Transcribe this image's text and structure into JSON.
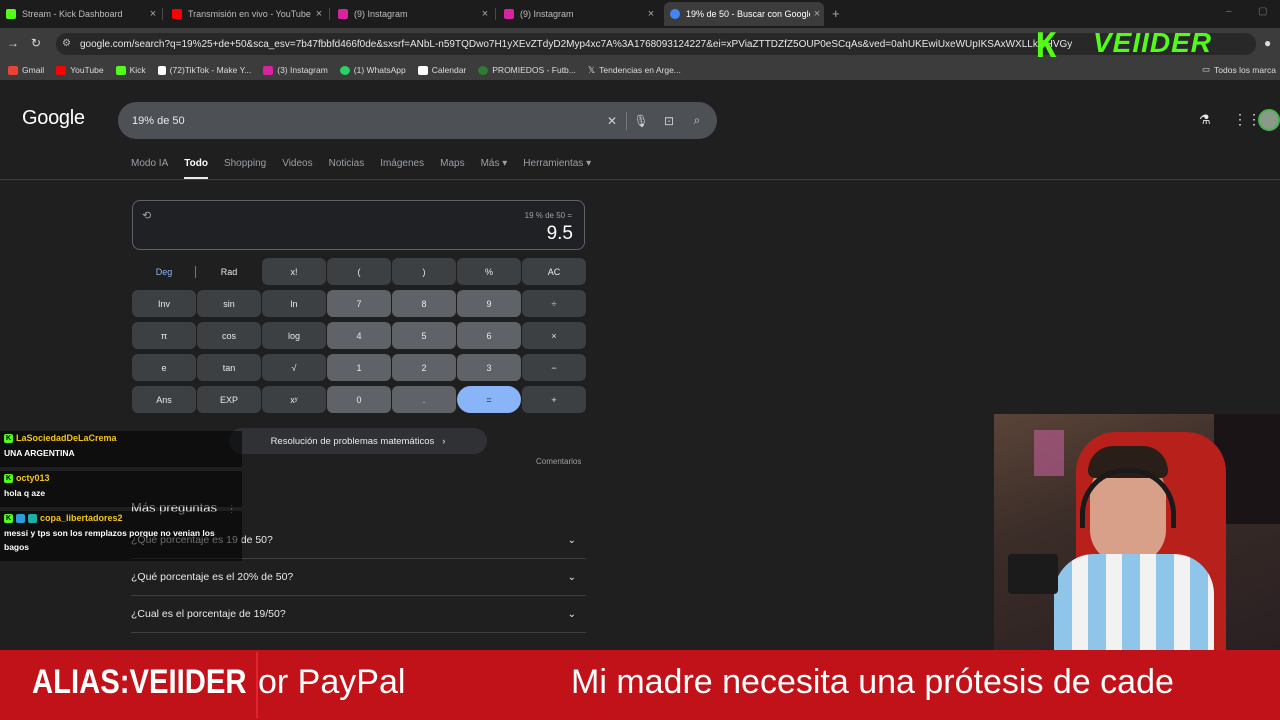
{
  "browser": {
    "tabs": [
      {
        "title": "Stream - Kick Dashboard",
        "icon": "kick-icon",
        "color": "#53fc18"
      },
      {
        "title": "Transmisión en vivo - YouTube",
        "icon": "youtube-icon",
        "color": "#ff0000"
      },
      {
        "title": "(9) Instagram",
        "icon": "instagram-icon",
        "color": "#d6249f"
      },
      {
        "title": "(9) Instagram",
        "icon": "instagram-icon",
        "color": "#d6249f"
      },
      {
        "title": "19% de 50 - Buscar con Google",
        "icon": "google-icon",
        "color": "#4285f4"
      }
    ],
    "url": "google.com/search?q=19%25+de+50&sca_esv=7b47fbbfd466f0de&sxsrf=ANbL-n59TQDwo7H1yXEvZTdyD2Myp4xc7A%3A1768093124227&ei=xPViaZTTDZfZ5OUP0eSCqAs&ved=0ahUKEwiUxeWUpIKSAxWXLLkGHVGy",
    "bookmarks": [
      {
        "label": "Gmail",
        "color": "#ea4335"
      },
      {
        "label": "YouTube",
        "color": "#ff0000"
      },
      {
        "label": "Kick",
        "color": "#53fc18"
      },
      {
        "label": "(72)TikTok - Make Y...",
        "color": "#ffffff"
      },
      {
        "label": "(3) Instagram",
        "color": "#d6249f"
      },
      {
        "label": "(1) WhatsApp",
        "color": "#25d366"
      },
      {
        "label": "Calendar",
        "color": "#ffffff"
      },
      {
        "label": "PROMIEDOS - Futb...",
        "color": "#2e7d32"
      },
      {
        "label": "Tendencias en Arge...",
        "color": "#ffffff"
      }
    ],
    "all_bookmarks": "Todos los marca"
  },
  "google": {
    "logo": "Google",
    "query": "19% de 50",
    "nav": [
      "Modo IA",
      "Todo",
      "Shopping",
      "Videos",
      "Noticias",
      "Imágenes",
      "Maps",
      "Más ▾",
      "Herramientas ▾"
    ],
    "active_nav": "Todo"
  },
  "calculator": {
    "expression": "19 % de 50 =",
    "result": "9.5",
    "rows": [
      [
        "Deg",
        "Rad",
        "x!",
        "(",
        ")",
        "%",
        "AC"
      ],
      [
        "Inv",
        "sin",
        "ln",
        "7",
        "8",
        "9",
        "÷"
      ],
      [
        "π",
        "cos",
        "log",
        "4",
        "5",
        "6",
        "×"
      ],
      [
        "e",
        "tan",
        "√",
        "1",
        "2",
        "3",
        "−"
      ],
      [
        "Ans",
        "EXP",
        "xʸ",
        "0",
        ".",
        "=",
        "+"
      ]
    ],
    "solve_button": "Resolución de problemas matemáticos",
    "comments": "Comentarios"
  },
  "more_questions": {
    "title": "Más preguntas",
    "items": [
      "¿Qué porcentaje es 19 de 50?",
      "¿Qué porcentaje es el 20% de 50?",
      "¿Cual es el porcentaje de 19/50?"
    ]
  },
  "chat": [
    {
      "user": "LaSociedadDeLaCrema",
      "user_color": "#f5c518",
      "message": "UNA ARGENTINA"
    },
    {
      "user": "octy013",
      "user_color": "#f5c518",
      "message": "hola q aze"
    },
    {
      "user": "copa_libertadores2",
      "user_color": "#f5c518",
      "message": "messi y tps son los remplazos porque no venian los bagos"
    }
  ],
  "overlay": {
    "brand_k": "K",
    "brand_name": "VEIIDER",
    "alias": "ALIAS:VEIIDER",
    "ticker_1": "or PayPal",
    "ticker_2": "Mi madre necesita una prótesis de cade",
    "ticker_color": "#c01218"
  }
}
